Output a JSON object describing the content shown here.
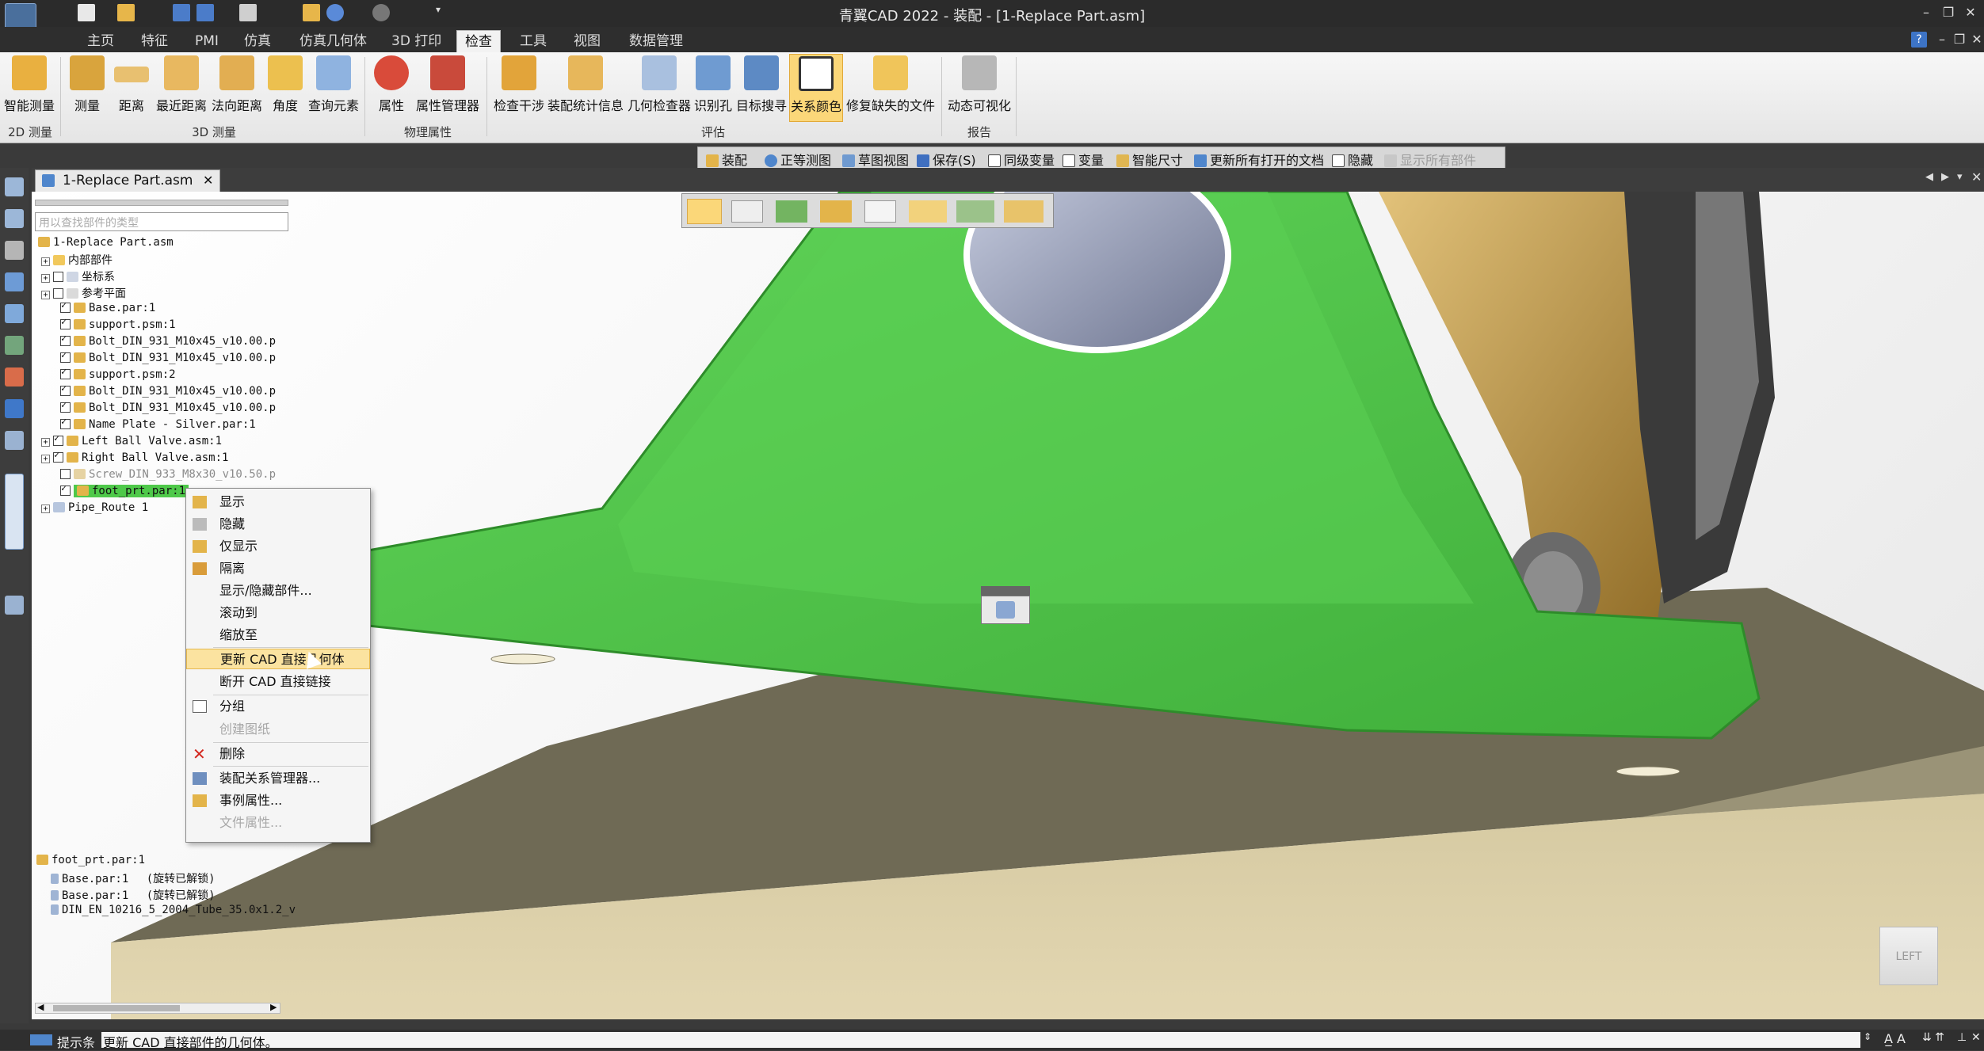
{
  "window": {
    "title": "青翼CAD 2022 - 装配 - [1-Replace Part.asm]"
  },
  "app_tabs": [
    {
      "label": "主页"
    },
    {
      "label": "特征"
    },
    {
      "label": "PMI"
    },
    {
      "label": "仿真"
    },
    {
      "label": "仿真几何体"
    },
    {
      "label": "3D 打印"
    },
    {
      "label": "检查"
    },
    {
      "label": "工具"
    },
    {
      "label": "视图"
    },
    {
      "label": "数据管理"
    }
  ],
  "ribbon": {
    "buttons": [
      {
        "label": "智能测量"
      },
      {
        "label": "测量"
      },
      {
        "label": "距离"
      },
      {
        "label": "最近距离"
      },
      {
        "label": "法向距离"
      },
      {
        "label": "角度"
      },
      {
        "label": "查询元素"
      },
      {
        "label": "属性"
      },
      {
        "label": "属性管理器"
      },
      {
        "label": "检查干涉"
      },
      {
        "label": "装配统计信息"
      },
      {
        "label": "几何检查器"
      },
      {
        "label": "识别孔"
      },
      {
        "label": "目标搜寻"
      },
      {
        "label": "关系颜色"
      },
      {
        "label": "修复缺失的文件"
      },
      {
        "label": "动态可视化"
      }
    ],
    "groups": [
      {
        "label": "2D 测量"
      },
      {
        "label": "3D 测量"
      },
      {
        "label": "物理属性"
      },
      {
        "label": "评估"
      },
      {
        "label": "报告"
      }
    ]
  },
  "command_bar": {
    "items": [
      {
        "label": "装配"
      },
      {
        "label": "正等测图"
      },
      {
        "label": "草图视图"
      },
      {
        "label": "保存(S)"
      },
      {
        "label": "同级变量"
      },
      {
        "label": "变量"
      },
      {
        "label": "智能尺寸"
      },
      {
        "label": "更新所有打开的文档"
      },
      {
        "label": "隐藏"
      },
      {
        "label": "显示所有部件"
      }
    ]
  },
  "document_tab": {
    "label": "1-Replace Part.asm"
  },
  "pathfinder": {
    "search_placeholder": "用以查找部件的类型",
    "rows": [
      {
        "label": "1-Replace Part.asm"
      },
      {
        "label": "内部部件"
      },
      {
        "label": "坐标系"
      },
      {
        "label": "参考平面"
      },
      {
        "label": "Base.par:1"
      },
      {
        "label": "support.psm:1"
      },
      {
        "label": "Bolt_DIN_931_M10x45_v10.00.p"
      },
      {
        "label": "Bolt_DIN_931_M10x45_v10.00.p"
      },
      {
        "label": "support.psm:2"
      },
      {
        "label": "Bolt_DIN_931_M10x45_v10.00.p"
      },
      {
        "label": "Bolt_DIN_931_M10x45_v10.00.p"
      },
      {
        "label": "Name Plate - Silver.par:1"
      },
      {
        "label": "Left Ball Valve.asm:1"
      },
      {
        "label": "Right Ball Valve.asm:1"
      },
      {
        "label": "Screw_DIN_933_M8x30_v10.50.p"
      },
      {
        "label": "foot_prt.par:1"
      },
      {
        "label": "Pipe_Route 1"
      }
    ],
    "relations": {
      "title": "foot_prt.par:1",
      "items": [
        {
          "label": "Base.par:1",
          "note": "(旋转已解锁)"
        },
        {
          "label": "Base.par:1",
          "note": "(旋转已解锁)"
        },
        {
          "label": "DIN_EN_10216_5_2004_Tube_35.0x1.2_v"
        }
      ]
    }
  },
  "context_menu": {
    "items": [
      {
        "label": "显示"
      },
      {
        "label": "隐藏"
      },
      {
        "label": "仅显示"
      },
      {
        "label": "隔离"
      },
      {
        "label": "显示/隐藏部件..."
      },
      {
        "label": "滚动到"
      },
      {
        "label": "缩放至"
      },
      {
        "label": "更新 CAD 直接几何体"
      },
      {
        "label": "断开 CAD 直接链接"
      },
      {
        "label": "分组"
      },
      {
        "label": "创建图纸"
      },
      {
        "label": "删除"
      },
      {
        "label": "装配关系管理器..."
      },
      {
        "label": "事例属性..."
      },
      {
        "label": "文件属性..."
      }
    ]
  },
  "view_cube": {
    "label": "LEFT"
  },
  "status": {
    "prompt_label": "提示条",
    "text": "更新 CAD 直接部件的几何体。"
  },
  "colors": {
    "accent": "#fbd779",
    "selection_green": "#4fc94a",
    "highlight": "#fbe3a0"
  }
}
